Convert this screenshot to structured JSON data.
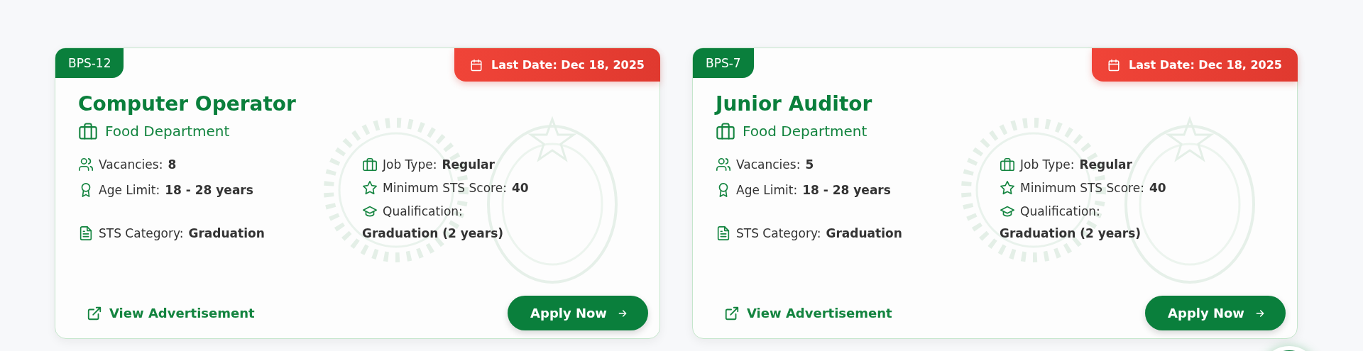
{
  "cards": [
    {
      "grade": "BPS-12",
      "last_date": "Last Date: Dec 18, 2025",
      "title": "Computer Operator",
      "department": "Food Department",
      "left_details": [
        {
          "kind": "vacancies",
          "label": "Vacancies:",
          "value": "8"
        },
        {
          "kind": "age",
          "label": "Age Limit:",
          "value": "18 - 28 years"
        },
        {
          "kind": "category",
          "label": "STS Category:",
          "value": "Graduation"
        }
      ],
      "right_details": [
        {
          "kind": "job_type",
          "label": "Job Type:",
          "value": "Regular"
        },
        {
          "kind": "score",
          "label": "Minimum STS Score:",
          "value": "40"
        },
        {
          "kind": "qualification",
          "label": "Qualification:",
          "value": "Graduation (2 years)"
        }
      ],
      "link": "View Advertisement",
      "button": "Apply Now"
    },
    {
      "grade": "BPS-7",
      "last_date": "Last Date: Dec 18, 2025",
      "title": "Junior Auditor",
      "department": "Food Department",
      "left_details": [
        {
          "kind": "vacancies",
          "label": "Vacancies:",
          "value": "5"
        },
        {
          "kind": "age",
          "label": "Age Limit:",
          "value": "18 - 28 years"
        },
        {
          "kind": "category",
          "label": "STS Category:",
          "value": "Graduation"
        }
      ],
      "right_details": [
        {
          "kind": "job_type",
          "label": "Job Type:",
          "value": "Regular"
        },
        {
          "kind": "score",
          "label": "Minimum STS Score:",
          "value": "40"
        },
        {
          "kind": "qualification",
          "label": "Qualification:",
          "value": "Graduation (2 years)"
        }
      ],
      "link": "View Advertisement",
      "button": "Apply Now"
    }
  ]
}
